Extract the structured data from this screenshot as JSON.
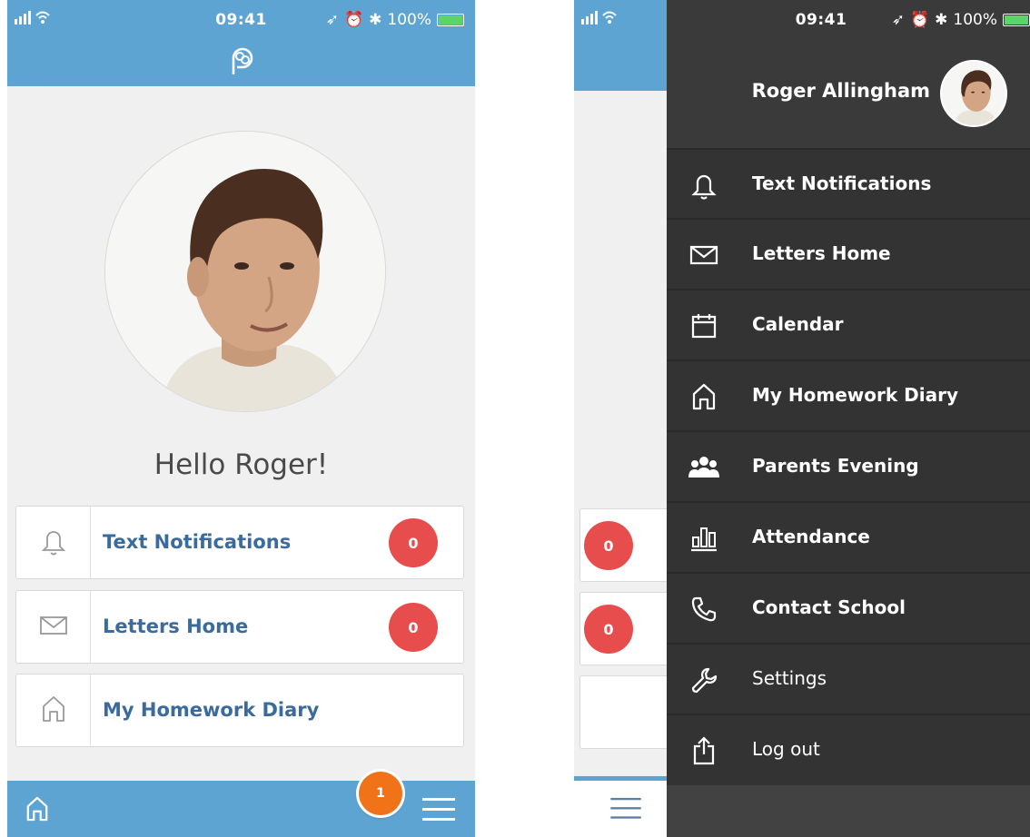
{
  "status": {
    "time": "09:41",
    "battery": "100%"
  },
  "home": {
    "greeting": "Hello Roger!",
    "cards": [
      {
        "label": "Text Notifications",
        "badge": "0",
        "icon": "bell-icon"
      },
      {
        "label": "Letters Home",
        "badge": "0",
        "icon": "envelope-icon"
      },
      {
        "label": "My Homework Diary",
        "icon": "house-icon"
      }
    ],
    "notification_badge": "1"
  },
  "drawer": {
    "user_name": "Roger Allingham",
    "items": [
      {
        "label": "Text Notifications",
        "icon": "bell-icon"
      },
      {
        "label": "Letters Home",
        "icon": "envelope-icon"
      },
      {
        "label": "Calendar",
        "icon": "calendar-icon"
      },
      {
        "label": "My Homework Diary",
        "icon": "house-icon"
      },
      {
        "label": "Parents Evening",
        "icon": "people-icon"
      },
      {
        "label": "Attendance",
        "icon": "bar-chart-icon"
      },
      {
        "label": "Contact School",
        "icon": "phone-icon"
      },
      {
        "label": "Settings",
        "icon": "wrench-icon"
      },
      {
        "label": "Log out",
        "icon": "share-icon"
      }
    ],
    "peek_badges": [
      "0",
      "0"
    ]
  },
  "colors": {
    "header_blue": "#5ea4d3",
    "drawer_dark": "#333333",
    "badge_red": "#e84d4d",
    "badge_orange": "#f0731a",
    "link_blue": "#3a6b9c"
  }
}
